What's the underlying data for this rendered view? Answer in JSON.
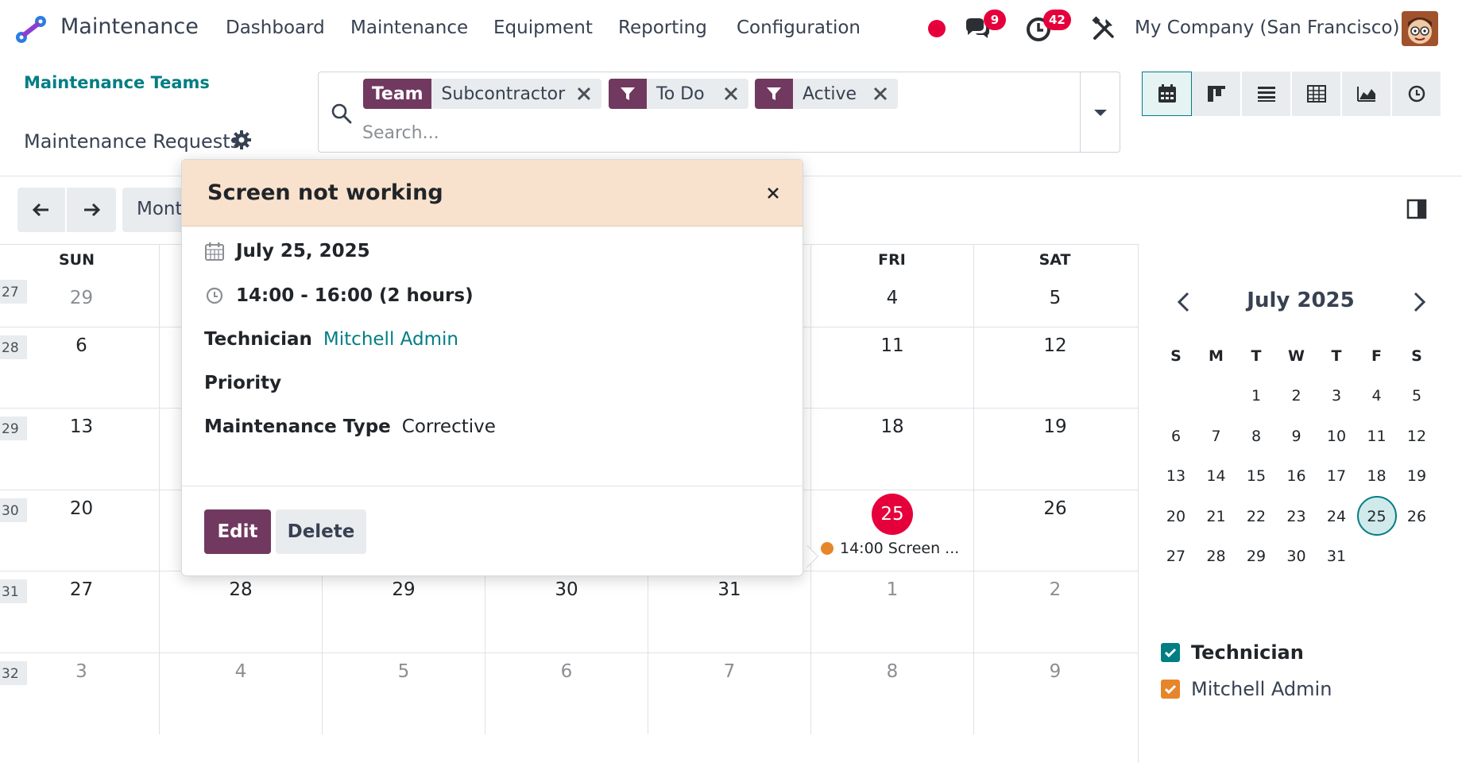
{
  "nav": {
    "app_name": "Maintenance",
    "menu": [
      "Dashboard",
      "Maintenance",
      "Equipment",
      "Reporting",
      "Configuration"
    ],
    "chat_badge": "9",
    "activity_badge": "42",
    "company": "My Company (San Francisco)"
  },
  "breadcrumb": {
    "parent": "Maintenance Teams",
    "current": "Maintenance Requests"
  },
  "search": {
    "facets": [
      {
        "tag": "Team",
        "value": "Subcontractor",
        "type": "groupby"
      },
      {
        "tag": "filter-icon",
        "value": "To Do",
        "type": "filter"
      },
      {
        "tag": "filter-icon",
        "value": "Active",
        "type": "filter"
      }
    ],
    "placeholder": "Search..."
  },
  "calendar": {
    "scale_label": "Month",
    "weekdays": [
      "SUN",
      "",
      "",
      "",
      "",
      "FRI",
      "SAT"
    ],
    "weeks": [
      {
        "num": "27",
        "days": [
          {
            "d": "29",
            "m": true
          },
          {
            "d": "",
            "m": false
          },
          {
            "d": "",
            "m": false
          },
          {
            "d": "",
            "m": false
          },
          {
            "d": "",
            "m": false
          },
          {
            "d": "4",
            "m": false
          },
          {
            "d": "5",
            "m": false
          }
        ]
      },
      {
        "num": "28",
        "days": [
          {
            "d": "6",
            "m": false
          },
          {
            "d": "",
            "m": false
          },
          {
            "d": "",
            "m": false
          },
          {
            "d": "",
            "m": false
          },
          {
            "d": "",
            "m": false
          },
          {
            "d": "11",
            "m": false
          },
          {
            "d": "12",
            "m": false
          }
        ]
      },
      {
        "num": "29",
        "days": [
          {
            "d": "13",
            "m": false
          },
          {
            "d": "",
            "m": false
          },
          {
            "d": "",
            "m": false
          },
          {
            "d": "",
            "m": false
          },
          {
            "d": "",
            "m": false
          },
          {
            "d": "18",
            "m": false
          },
          {
            "d": "19",
            "m": false
          }
        ]
      },
      {
        "num": "30",
        "days": [
          {
            "d": "20",
            "m": false
          },
          {
            "d": "",
            "m": false
          },
          {
            "d": "",
            "m": false
          },
          {
            "d": "",
            "m": false
          },
          {
            "d": "",
            "m": false
          },
          {
            "d": "25",
            "m": false,
            "today": true
          },
          {
            "d": "26",
            "m": false
          }
        ]
      },
      {
        "num": "31",
        "days": [
          {
            "d": "27",
            "m": false
          },
          {
            "d": "28",
            "m": false
          },
          {
            "d": "29",
            "m": false
          },
          {
            "d": "30",
            "m": false
          },
          {
            "d": "31",
            "m": false
          },
          {
            "d": "1",
            "m": true
          },
          {
            "d": "2",
            "m": true
          }
        ]
      },
      {
        "num": "32",
        "days": [
          {
            "d": "3",
            "m": true
          },
          {
            "d": "4",
            "m": true
          },
          {
            "d": "5",
            "m": true
          },
          {
            "d": "6",
            "m": true
          },
          {
            "d": "7",
            "m": true
          },
          {
            "d": "8",
            "m": true
          },
          {
            "d": "9",
            "m": true
          }
        ]
      }
    ],
    "event": {
      "label": "14:00 Screen ...",
      "color": "#e6862a"
    }
  },
  "mini_calendar": {
    "title": "July 2025",
    "headers": [
      "S",
      "M",
      "T",
      "W",
      "T",
      "F",
      "S"
    ],
    "rows": [
      [
        "",
        "",
        "1",
        "2",
        "3",
        "4",
        "5"
      ],
      [
        "6",
        "7",
        "8",
        "9",
        "10",
        "11",
        "12"
      ],
      [
        "13",
        "14",
        "15",
        "16",
        "17",
        "18",
        "19"
      ],
      [
        "20",
        "21",
        "22",
        "23",
        "24",
        "25",
        "26"
      ],
      [
        "27",
        "28",
        "29",
        "30",
        "31",
        "",
        ""
      ]
    ],
    "selected": "25"
  },
  "filters": {
    "section_label": "Technician",
    "items": [
      {
        "label": "Mitchell Admin",
        "color": "#e6862a"
      }
    ]
  },
  "popover": {
    "title": "Screen not working",
    "date": "July 25, 2025",
    "time": "14:00 - 16:00",
    "duration": "(2 hours)",
    "technician_label": "Technician",
    "technician_value": "Mitchell Admin",
    "priority_label": "Priority",
    "type_label": "Maintenance Type",
    "type_value": "Corrective",
    "edit_label": "Edit",
    "delete_label": "Delete"
  }
}
